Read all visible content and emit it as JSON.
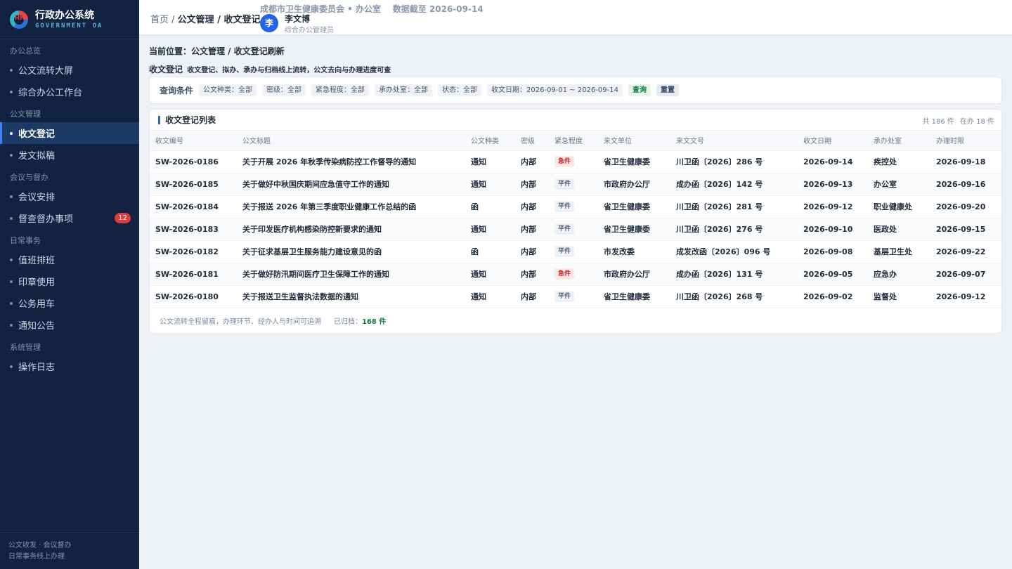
{
  "brand": {
    "title": "行政办公系统",
    "subtitle": "GOVERNMENT OA",
    "logo_icon": "RK"
  },
  "sidebar": {
    "groups": [
      {
        "label": "办公总览",
        "items": [
          {
            "label": "公文流转大屏"
          },
          {
            "label": "综合办公工作台"
          }
        ]
      },
      {
        "label": "公文管理",
        "items": [
          {
            "label": "收文登记",
            "active": true
          },
          {
            "label": "发文拟稿"
          }
        ]
      },
      {
        "label": "会议与督办",
        "items": [
          {
            "label": "会议安排"
          },
          {
            "label": "督查督办事项",
            "badge": "12"
          }
        ]
      },
      {
        "label": "日常事务",
        "items": [
          {
            "label": "值班排班"
          },
          {
            "label": "印章使用"
          },
          {
            "label": "公务用车"
          },
          {
            "label": "通知公告"
          }
        ]
      },
      {
        "label": "系统管理",
        "items": [
          {
            "label": "操作日志"
          }
        ]
      }
    ],
    "footer_line1": "公文收发 · 会议督办",
    "footer_line2": "日常事务线上办理"
  },
  "topbar": {
    "crumb_home": "首页",
    "crumb_sep": " / ",
    "crumb_path": "公文管理 / 收文登记",
    "org_line": "成都市卫生健康委员会 • 办公室    数据截至 2026-09-14",
    "avatar_text": "李",
    "user_name": "李文博",
    "user_role": "综合办公管理员"
  },
  "main": {
    "location": "当前位置：公文管理 / 收文登记刷新",
    "title": "收文登记",
    "description": "收文登记、拟办、承办与归档线上流转，公文去向与办理进度可查",
    "filter": {
      "label": "查询条件",
      "chips": [
        "公文种类：全部",
        "密级：全部",
        "紧急程度：全部",
        "承办处室：全部",
        "状态：全部",
        "收文日期：2026-09-01 ~ 2026-09-14"
      ],
      "query_label": "查询",
      "reset_label": "重置"
    },
    "list": {
      "title": "收文登记列表",
      "total": "共 186 件",
      "in_progress": "在办 18 件",
      "columns": [
        "收文编号",
        "公文标题",
        "公文种类",
        "密级",
        "紧急程度",
        "来文单位",
        "来文文号",
        "收文日期",
        "承办处室",
        "办理时限"
      ],
      "rows": [
        [
          "SW-2026-0186",
          "关于开展 2026 年秋季传染病防控工作督导的通知",
          "通知",
          "内部",
          "急件",
          "省卫生健康委",
          "川卫函〔2026〕286 号",
          "2026-09-14",
          "疾控处",
          "2026-09-18"
        ],
        [
          "SW-2026-0185",
          "关于做好中秋国庆期间应急值守工作的通知",
          "通知",
          "内部",
          "平件",
          "市政府办公厅",
          "成办函〔2026〕142 号",
          "2026-09-13",
          "办公室",
          "2026-09-16"
        ],
        [
          "SW-2026-0184",
          "关于报送 2026 年第三季度职业健康工作总结的函",
          "函",
          "内部",
          "平件",
          "省卫生健康委",
          "川卫函〔2026〕281 号",
          "2026-09-12",
          "职业健康处",
          "2026-09-20"
        ],
        [
          "SW-2026-0183",
          "关于印发医疗机构感染防控新要求的通知",
          "通知",
          "内部",
          "平件",
          "省卫生健康委",
          "川卫函〔2026〕276 号",
          "2026-09-10",
          "医政处",
          "2026-09-15"
        ],
        [
          "SW-2026-0182",
          "关于征求基层卫生服务能力建设意见的函",
          "函",
          "内部",
          "平件",
          "市发改委",
          "成发改函〔2026〕096 号",
          "2026-09-08",
          "基层卫生处",
          "2026-09-22"
        ],
        [
          "SW-2026-0181",
          "关于做好防汛期间医疗卫生保障工作的通知",
          "通知",
          "内部",
          "急件",
          "市政府办公厅",
          "成办函〔2026〕131 号",
          "2026-09-05",
          "应急办",
          "2026-09-07"
        ],
        [
          "SW-2026-0180",
          "关于报送卫生监督执法数据的通知",
          "通知",
          "内部",
          "平件",
          "省卫生健康委",
          "川卫函〔2026〕268 号",
          "2026-09-02",
          "监督处",
          "2026-09-12"
        ]
      ],
      "footer_note": "公文流转全程留痕，办理环节、经办人与时间可追溯",
      "archived_label": "已归档：",
      "archived_value": "168 件"
    }
  },
  "colors": {
    "sidebar_bg": "#112340",
    "accent": "#2563eb",
    "urgent": "#c62828",
    "success": "#137a3e"
  }
}
